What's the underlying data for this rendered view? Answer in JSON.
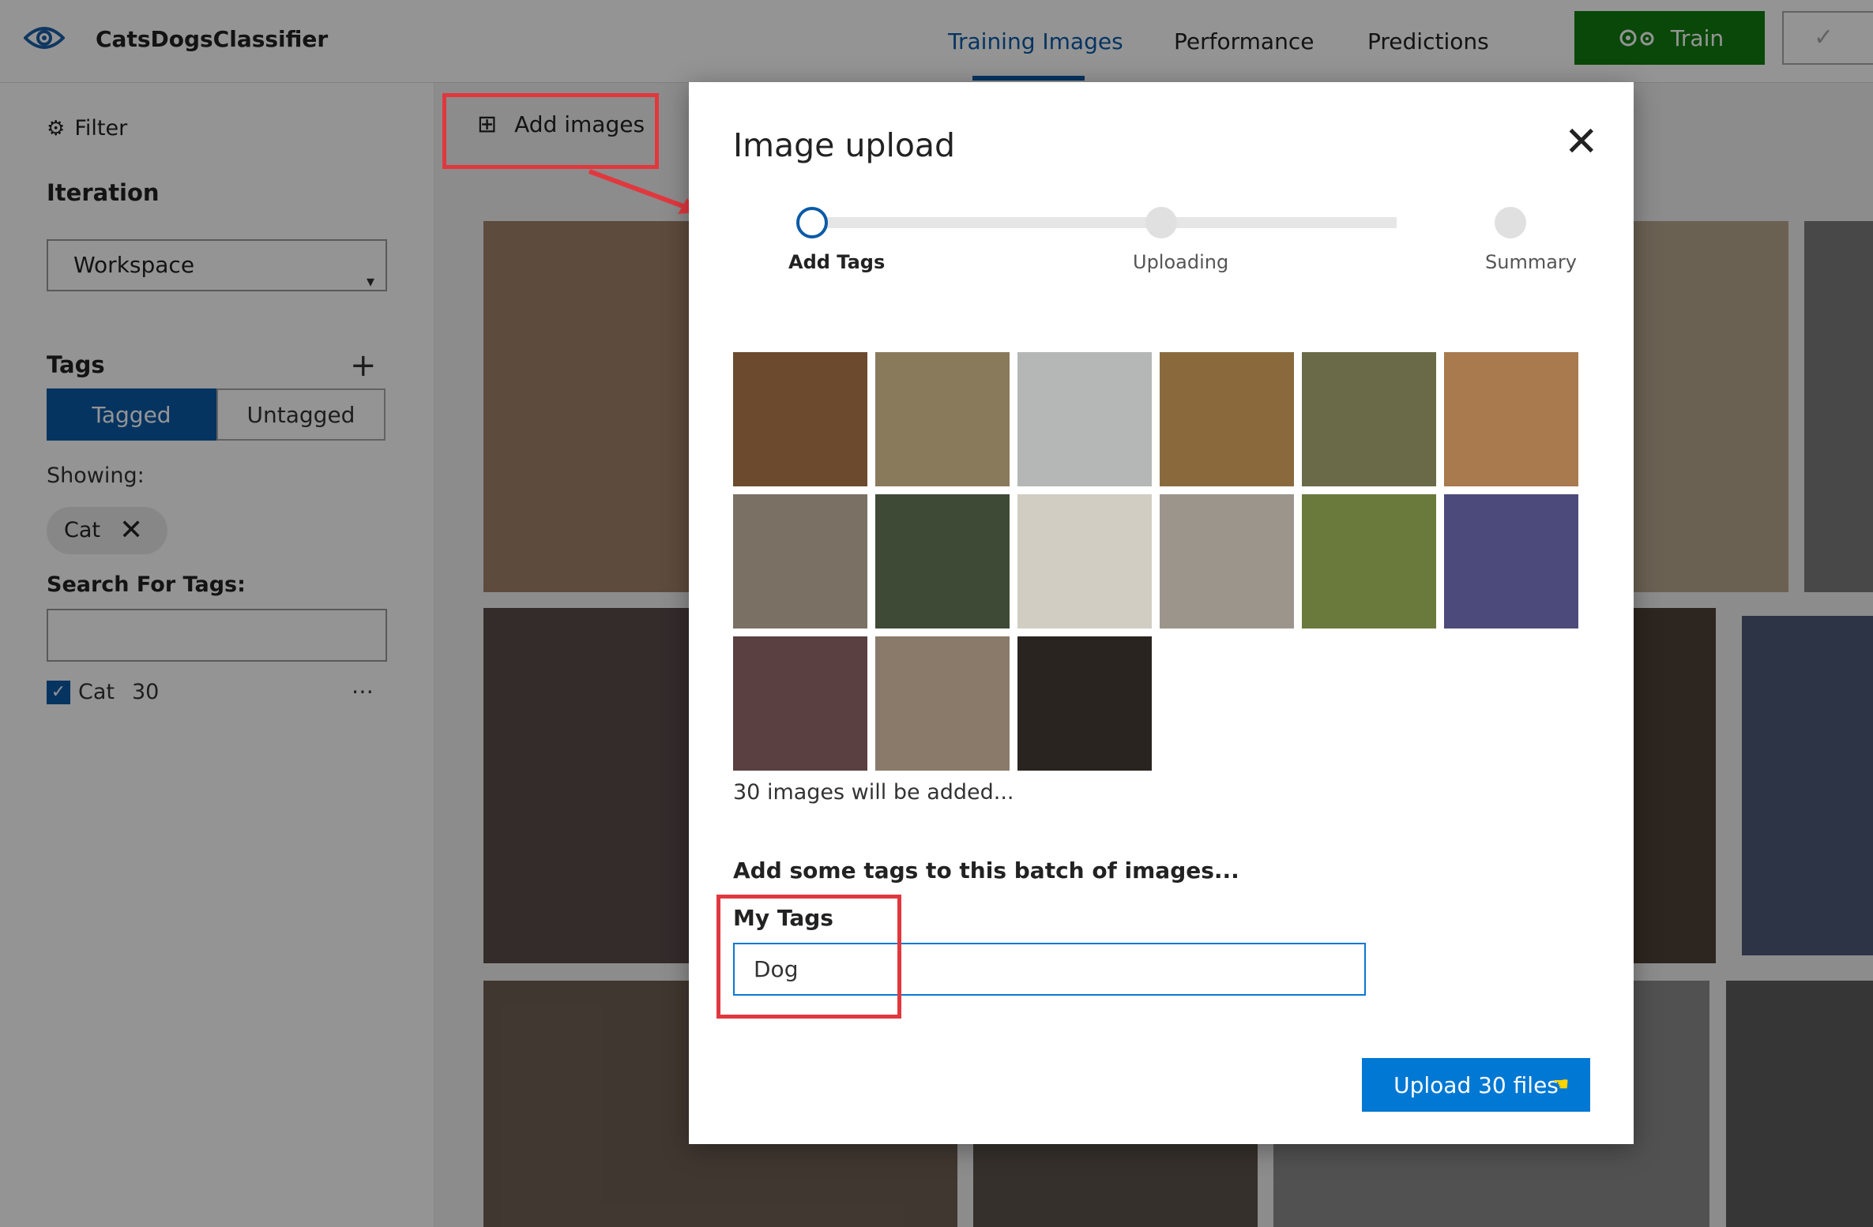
{
  "app": {
    "title": "CatsDogsClassifier"
  },
  "nav": {
    "tabs": [
      "Training Images",
      "Performance",
      "Predictions"
    ],
    "active": "Training Images"
  },
  "toolbar": {
    "train_label": "Train"
  },
  "sidebar": {
    "filter_label": "Filter",
    "iteration_label": "Iteration",
    "iteration_value": "Workspace",
    "tags_label": "Tags",
    "tagged_label": "Tagged",
    "untagged_label": "Untagged",
    "showing_label": "Showing:",
    "showing_chip": "Cat",
    "search_label": "Search For Tags:",
    "tag_items": [
      {
        "name": "Cat",
        "count": "30",
        "checked": true
      }
    ]
  },
  "main": {
    "add_images_label": "Add images"
  },
  "modal": {
    "title": "Image upload",
    "steps": [
      "Add Tags",
      "Uploading",
      "Summary"
    ],
    "current_step": 0,
    "image_count_text": "30 images will be added...",
    "batch_prompt": "Add some tags to this batch of images...",
    "tags_field_label": "My Tags",
    "tags_field_value": "Dog",
    "upload_button_label": "Upload 30 files"
  },
  "colors": {
    "accent": "#0a5aa8",
    "train_green": "#107c10",
    "annotation_red": "#e0383e",
    "upload_blue": "#0078d4"
  }
}
